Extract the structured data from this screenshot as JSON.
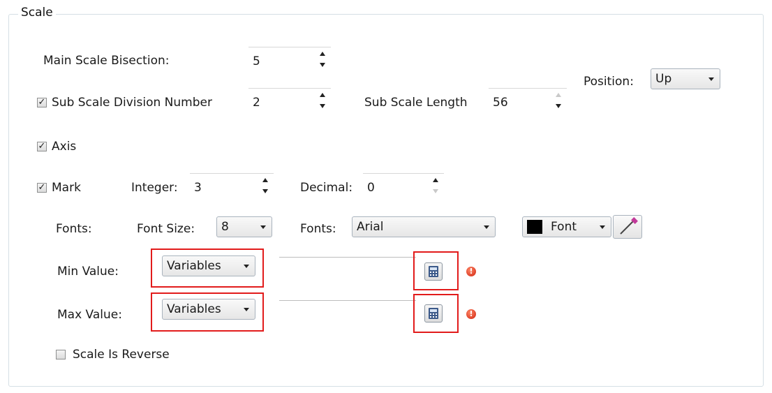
{
  "group": {
    "title": "Scale"
  },
  "main_scale": {
    "label": "Main Scale Bisection:",
    "value": "5"
  },
  "sub_scale": {
    "checked": true,
    "label": "Sub Scale Division Number",
    "value": "2",
    "length_label": "Sub Scale Length",
    "length_value": "56"
  },
  "position": {
    "label": "Position:",
    "value": "Up"
  },
  "axis": {
    "checked": true,
    "label": "Axis"
  },
  "mark": {
    "checked": true,
    "label": "Mark",
    "integer_label": "Integer:",
    "integer_value": "3",
    "decimal_label": "Decimal:",
    "decimal_value": "0"
  },
  "fonts": {
    "label": "Fonts:",
    "size_label": "Font Size:",
    "size_value": "8",
    "family_label": "Fonts:",
    "family_value": "Arial",
    "color_label": "Font",
    "color_swatch": "#000000"
  },
  "min_value": {
    "label": "Min Value:",
    "type": "Variables",
    "value": ""
  },
  "max_value": {
    "label": "Max Value:",
    "type": "Variables",
    "value": ""
  },
  "reverse": {
    "checked": false,
    "label": "Scale Is Reverse"
  },
  "colors": {
    "highlight": "#e21b1b",
    "border": "#d5dfe5",
    "warning": "#d0200c"
  },
  "icons": [
    "checkbox-icon",
    "spin-up-icon",
    "spin-down-icon",
    "dropdown-caret-icon",
    "calculator-icon",
    "warning-icon",
    "eyedropper-icon"
  ]
}
